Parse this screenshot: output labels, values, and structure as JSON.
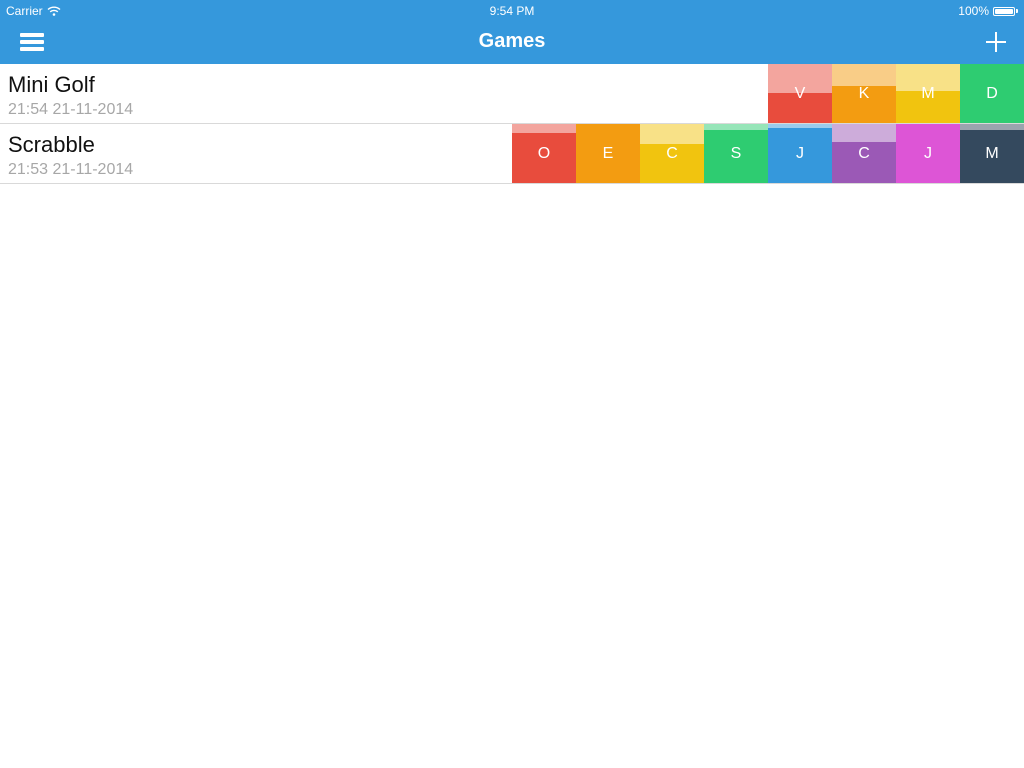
{
  "status_bar": {
    "carrier": "Carrier",
    "time": "9:54 PM",
    "battery": "100%",
    "battery_level": 1.0
  },
  "nav": {
    "title": "Games"
  },
  "games": [
    {
      "name": "Mini Golf",
      "date": "21:54 21-11-2014",
      "players": [
        {
          "initial": "V",
          "color": "#e84c3d",
          "light": "#f3a59e",
          "fill": 0.5
        },
        {
          "initial": "K",
          "color": "#f39c11",
          "light": "#f9cd87",
          "fill": 0.63
        },
        {
          "initial": "M",
          "color": "#f1c40f",
          "light": "#f8e187",
          "fill": 0.55
        },
        {
          "initial": "D",
          "color": "#2ecc71",
          "light": "#96e5b8",
          "fill": 1.0
        }
      ]
    },
    {
      "name": "Scrabble",
      "date": "21:53 21-11-2014",
      "players": [
        {
          "initial": "O",
          "color": "#e84c3d",
          "light": "#f3a59e",
          "fill": 0.84
        },
        {
          "initial": "E",
          "color": "#f39c11",
          "light": "#f9cd87",
          "fill": 1.0
        },
        {
          "initial": "C",
          "color": "#f1c40f",
          "light": "#f8e187",
          "fill": 0.66
        },
        {
          "initial": "S",
          "color": "#2ecc71",
          "light": "#96e5b8",
          "fill": 0.9
        },
        {
          "initial": "J",
          "color": "#3598dc",
          "light": "#9acbed",
          "fill": 0.93
        },
        {
          "initial": "C",
          "color": "#9b59b6",
          "light": "#cdacda",
          "fill": 0.7
        },
        {
          "initial": "J",
          "color": "#dd55d6",
          "light": "#eeaaeb",
          "fill": 1.0
        },
        {
          "initial": "M",
          "color": "#34495e",
          "light": "#9aa4ae",
          "fill": 0.9
        }
      ]
    }
  ]
}
